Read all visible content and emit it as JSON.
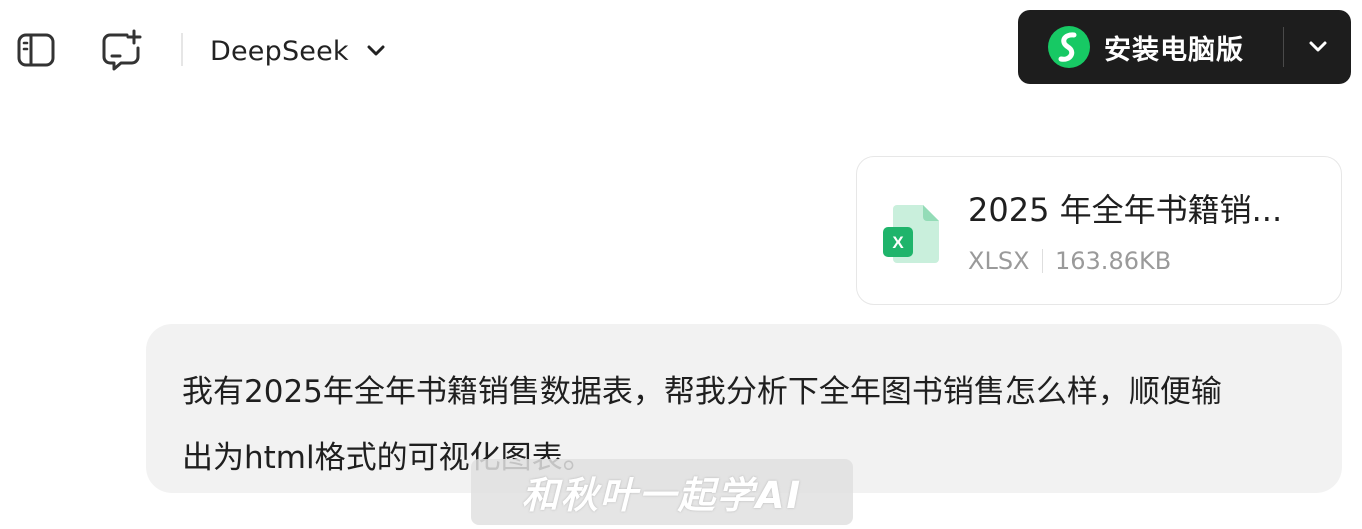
{
  "header": {
    "sidebar_toggle_icon": "sidebar-panel-icon",
    "new_chat_icon": "new-chat-icon",
    "model_name": "DeepSeek",
    "model_dropdown_icon": "chevron-down-icon",
    "install_button": {
      "label": "安装电脑版",
      "logo_icon": "app-logo-icon",
      "dropdown_icon": "chevron-down-icon",
      "logo_color": "#17c964",
      "background": "#1d1d1d"
    }
  },
  "attachment": {
    "file_name": "2025 年全年书籍销...",
    "file_type": "XLSX",
    "file_size": "163.86KB",
    "icon": "excel-file-icon",
    "icon_color": "#1fb46b"
  },
  "message": {
    "text": "我有2025年全年书籍销售数据表，帮我分析下全年图书销售怎么样，顺便输出为html格式的可视化图表。"
  },
  "watermark": {
    "text": "和秋叶一起学AI"
  }
}
